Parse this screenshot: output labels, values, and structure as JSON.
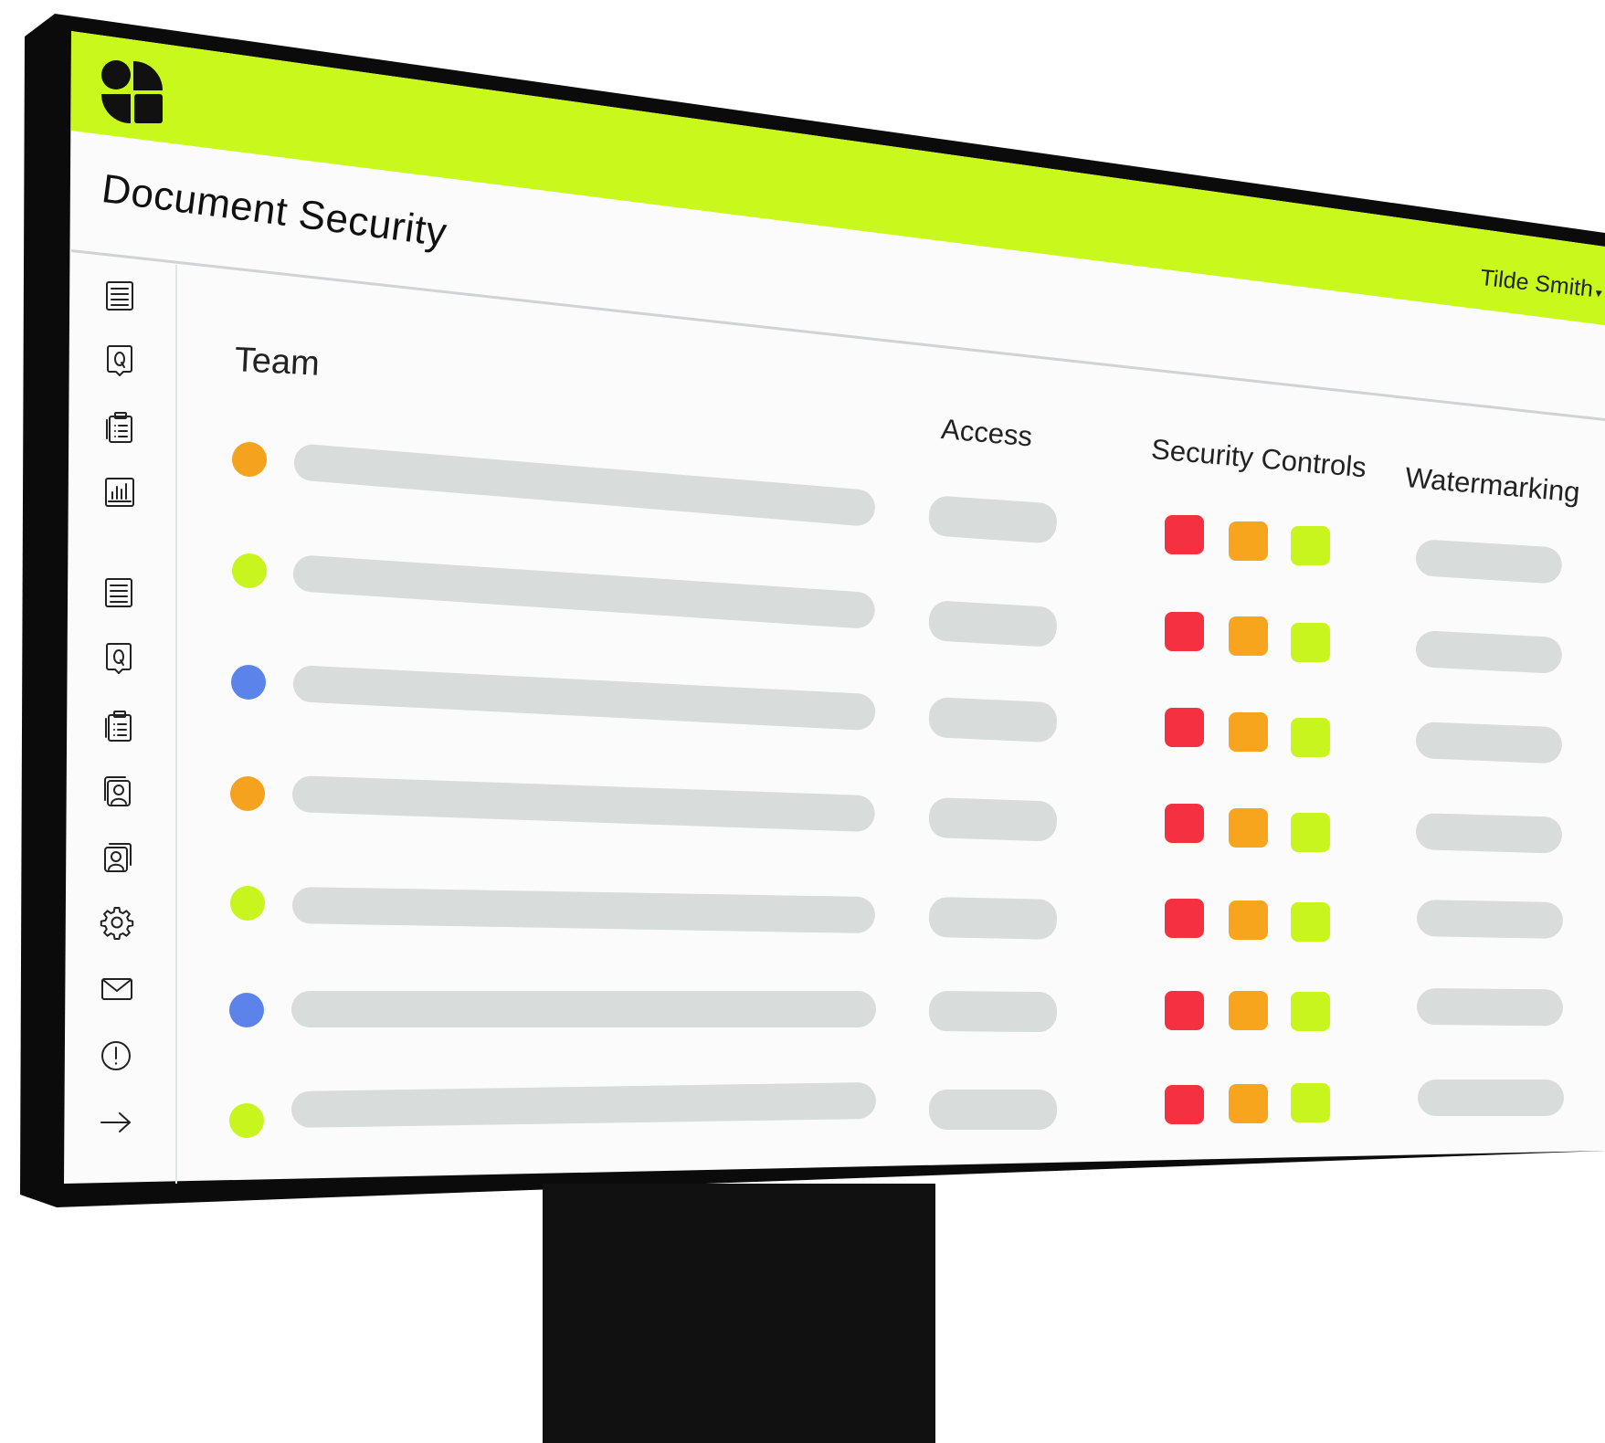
{
  "app": {
    "page_title": "Document Security",
    "user_name": "Tilde Smith",
    "user_caret": "▾"
  },
  "colors": {
    "brand_green": "#c8f81c",
    "dot_orange": "#f5a21f",
    "dot_lime": "#c8f51e",
    "dot_blue": "#5b83ea",
    "control_red": "#f53040",
    "control_orange": "#f8a51e",
    "control_lime": "#c8f51e",
    "placeholder_gray": "#d8dcdb"
  },
  "sidebar": {
    "items": [
      {
        "icon": "list-document-icon"
      },
      {
        "icon": "q-chat-icon"
      },
      {
        "icon": "clipboard-list-icon"
      },
      {
        "icon": "bar-chart-icon"
      },
      {
        "icon": "list-document-icon"
      },
      {
        "icon": "q-chat-icon"
      },
      {
        "icon": "clipboard-list-icon"
      },
      {
        "icon": "user-card-icon"
      },
      {
        "icon": "user-cards-icon"
      },
      {
        "icon": "gear-icon"
      },
      {
        "icon": "mail-icon"
      },
      {
        "icon": "alert-icon"
      },
      {
        "icon": "arrow-right-icon"
      }
    ]
  },
  "main": {
    "section_title": "Team",
    "columns": {
      "access": "Access",
      "security_controls": "Security Controls",
      "watermarking": "Watermarking"
    },
    "rows": [
      {
        "status": "orange"
      },
      {
        "status": "lime"
      },
      {
        "status": "blue"
      },
      {
        "status": "orange"
      },
      {
        "status": "lime"
      },
      {
        "status": "blue"
      },
      {
        "status": "lime"
      }
    ]
  }
}
